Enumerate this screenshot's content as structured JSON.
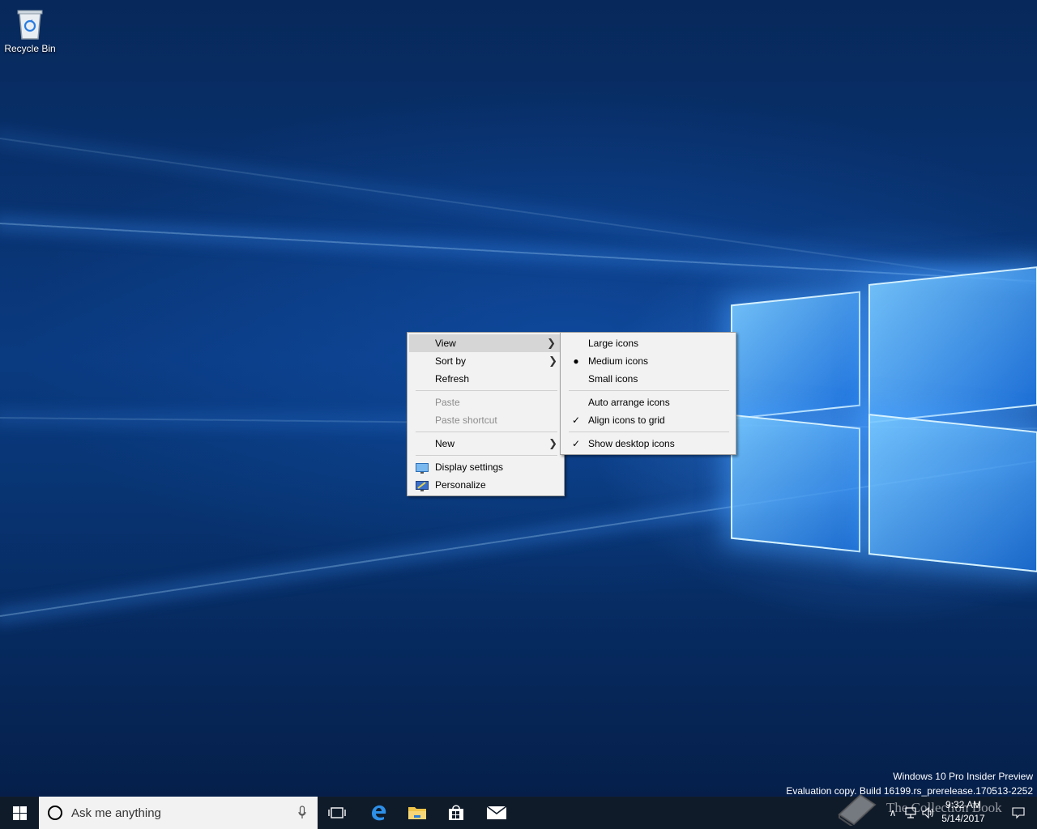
{
  "desktop": {
    "icons": [
      {
        "label": "Recycle Bin",
        "icon": "recycle-bin-icon"
      }
    ],
    "watermark": {
      "line1": "Windows 10 Pro Insider Preview",
      "line2": "Evaluation copy. Build 16199.rs_prerelease.170513-2252"
    }
  },
  "context_menu": {
    "view": "View",
    "sort_by": "Sort by",
    "refresh": "Refresh",
    "paste": "Paste",
    "paste_shortcut": "Paste shortcut",
    "new": "New",
    "display_settings": "Display settings",
    "personalize": "Personalize"
  },
  "view_submenu": {
    "large_icons": "Large icons",
    "medium_icons": "Medium icons",
    "small_icons": "Small icons",
    "auto_arrange": "Auto arrange icons",
    "align_to_grid": "Align icons to grid",
    "show_desktop_icons": "Show desktop icons",
    "selected_size": "Medium icons",
    "checked": [
      "Align icons to grid",
      "Show desktop icons"
    ]
  },
  "taskbar": {
    "search_placeholder": "Ask me anything",
    "pinned": [
      "edge-icon",
      "file-explorer-icon",
      "store-icon",
      "mail-icon"
    ],
    "clock_time": "9:32 AM",
    "clock_date": "5/14/2017"
  },
  "overlay_watermark": "The Collection Book",
  "colors": {
    "taskbar": "#101b2a",
    "menu_bg": "#f2f2f2",
    "menu_highlight": "#d6d6d6",
    "accent": "#0078d7"
  }
}
